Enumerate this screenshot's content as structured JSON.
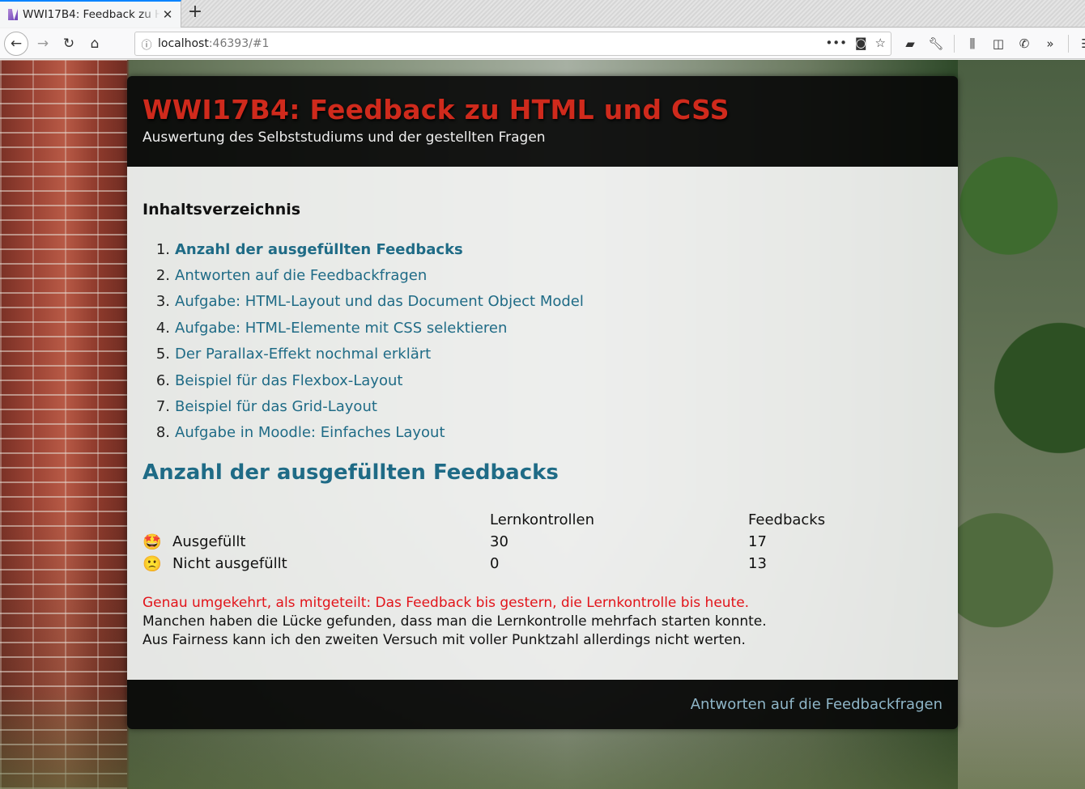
{
  "browser": {
    "tab_title": "WWI17B4: Feedback zu HTML und CSS",
    "new_tab_symbol": "+",
    "url_host": "localhost",
    "url_rest": ":46393/#1",
    "icons": [
      "back-icon",
      "forward-icon",
      "reload-icon",
      "home-icon",
      "info-icon",
      "more-icon",
      "pocket-icon",
      "bookmark-star-icon",
      "extension-icon",
      "wrench-icon",
      "library-icon",
      "sidebar-icon",
      "addon-icon",
      "overflow-icon",
      "menu-icon"
    ]
  },
  "header": {
    "title": "WWI17B4: Feedback zu HTML und CSS",
    "subtitle": "Auswertung des Selbststudiums und der gestellten Fragen"
  },
  "toc": {
    "heading": "Inhaltsverzeichnis",
    "items": [
      {
        "num": "1.",
        "label": "Anzahl der ausgefüllten Feedbacks"
      },
      {
        "num": "2.",
        "label": "Antworten auf die Feedbackfragen"
      },
      {
        "num": "3.",
        "label": "Aufgabe: HTML-Layout und das Document Object Model"
      },
      {
        "num": "4.",
        "label": "Aufgabe: HTML-Elemente mit CSS selektieren"
      },
      {
        "num": "5.",
        "label": "Der Parallax-Effekt nochmal erklärt"
      },
      {
        "num": "6.",
        "label": "Beispiel für das Flexbox-Layout"
      },
      {
        "num": "7.",
        "label": "Beispiel für das Grid-Layout"
      },
      {
        "num": "8.",
        "label": "Aufgabe in Moodle: Einfaches Layout"
      }
    ]
  },
  "section": {
    "heading": "Anzahl der ausgefüllten Feedbacks",
    "table": {
      "headers": [
        "",
        "Lernkontrollen",
        "Feedbacks"
      ],
      "rows": [
        {
          "emoji": "🤩",
          "label": "Ausgefüllt",
          "lernkontrollen": "30",
          "feedbacks": "17"
        },
        {
          "emoji": "🙁",
          "label": "Nicht ausgefüllt",
          "lernkontrollen": "0",
          "feedbacks": "13"
        }
      ]
    },
    "note_red": "Genau umgekehrt, als mitgeteilt: Das Feedback bis gestern, die Lernkontrolle bis heute.",
    "note_1": "Manchen haben die Lücke gefunden, dass man die Lernkontrolle mehrfach starten konnte.",
    "note_2": "Aus Fairness kann ich den zweiten Versuch mit voller Punktzahl allerdings nicht werten."
  },
  "footer": {
    "next_link": "Antworten auf die Feedbackfragen"
  },
  "colors": {
    "title_red": "#cf2a1c",
    "link_teal": "#1f6b86",
    "note_red": "#e2141a"
  }
}
